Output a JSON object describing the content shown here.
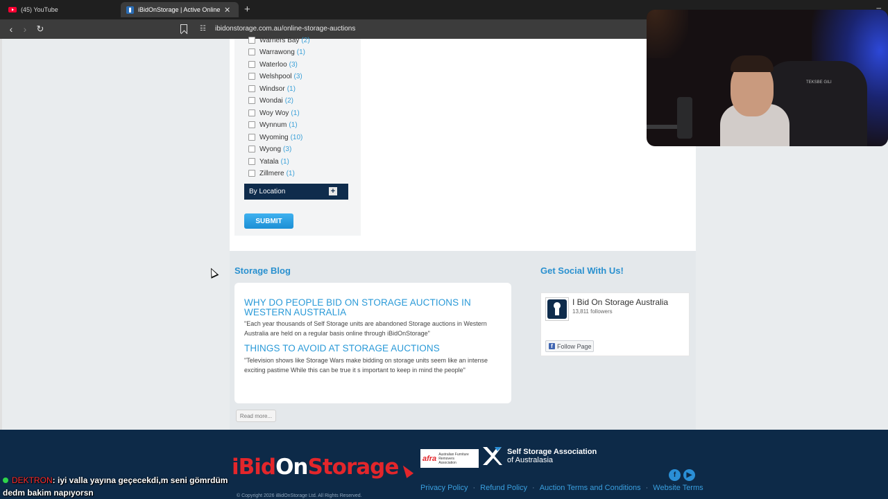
{
  "browser": {
    "tabs": [
      {
        "title": "(45) YouTube",
        "active": false
      },
      {
        "title": "iBidOnStorage | Active Online St",
        "active": true
      }
    ],
    "url": "ibidonstorage.com.au/online-storage-auctions"
  },
  "filters": {
    "items": [
      {
        "label": "Warners Bay",
        "count": "(2)"
      },
      {
        "label": "Warrawong",
        "count": "(1)"
      },
      {
        "label": "Waterloo",
        "count": "(3)"
      },
      {
        "label": "Welshpool",
        "count": "(3)"
      },
      {
        "label": "Windsor",
        "count": "(1)"
      },
      {
        "label": "Wondai",
        "count": "(2)"
      },
      {
        "label": "Woy Woy",
        "count": "(1)"
      },
      {
        "label": "Wynnum",
        "count": "(1)"
      },
      {
        "label": "Wyoming",
        "count": "(10)"
      },
      {
        "label": "Wyong",
        "count": "(3)"
      },
      {
        "label": "Yatala",
        "count": "(1)"
      },
      {
        "label": "Zillmere",
        "count": "(1)"
      }
    ],
    "by_location_label": "By Location",
    "submit_label": "SUBMIT"
  },
  "blog": {
    "heading": "Storage Blog",
    "posts": [
      {
        "title": "WHY DO PEOPLE BID ON STORAGE AUCTIONS IN WESTERN AUSTRALIA",
        "excerpt": "\"Each year thousands of Self Storage units are abandoned Storage auctions in Western Australia are held on a regular basis online through iBidOnStorage\""
      },
      {
        "title": "THINGS TO AVOID AT STORAGE AUCTIONS",
        "excerpt": "\"Television shows like Storage Wars make bidding on storage units seem like an intense exciting pastime While this can be true it s important to keep in mind the people\""
      }
    ],
    "read_more": "Read more..."
  },
  "social": {
    "heading": "Get Social With Us!",
    "page_name": "I Bid On Storage Australia",
    "followers": "13,811 followers",
    "follow_label": "Follow Page"
  },
  "footer": {
    "logo_text_1": "iBid",
    "logo_text_2": "On",
    "logo_text_3": "Storage",
    "copyright": "© Copyright 2026 iBidOnStorage Ltd. All Rights Reserved.",
    "afra_mark": "afra",
    "afra_text": "Australian Furniture Removers Association",
    "ssa_line1": "Self Storage Association",
    "ssa_line2": "of Australasia",
    "links": [
      "Privacy Policy",
      "Refund Policy",
      "Auction Terms and Conditions",
      "Website Terms"
    ]
  },
  "chat": {
    "user": "DEKTRON",
    "message_line1": ": iyi valla yayına geçecekdi,m seni gömrdüm",
    "message_line2": "dedm bakim napıyorsn"
  },
  "webcam": {
    "chair_brand": "TEKSBE GILI"
  }
}
